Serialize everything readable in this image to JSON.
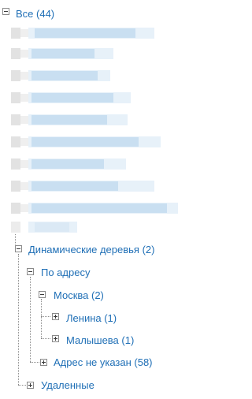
{
  "tree": {
    "root": {
      "label": "Все (44)",
      "toggle": "minus"
    },
    "hidden_rows_count": 10,
    "dynamic_trees": {
      "label": "Динамические деревья (2)",
      "toggle": "minus"
    },
    "by_address": {
      "label": "По адресу",
      "toggle": "minus"
    },
    "moscow": {
      "label": "Москва (2)",
      "toggle": "minus"
    },
    "lenina": {
      "label": "Ленина (1)",
      "toggle": "plus"
    },
    "malysheva": {
      "label": "Малышева (1)",
      "toggle": "plus"
    },
    "no_address": {
      "label": "Адрес не указан (58)",
      "toggle": "plus"
    },
    "deleted": {
      "label": "Удаленные",
      "toggle": "plus"
    }
  },
  "colors": {
    "link": "#1f6fb6",
    "connector": "#8c8c8c",
    "blur_blue": "#c9dff1",
    "blur_gray": "#e2e2e2"
  }
}
